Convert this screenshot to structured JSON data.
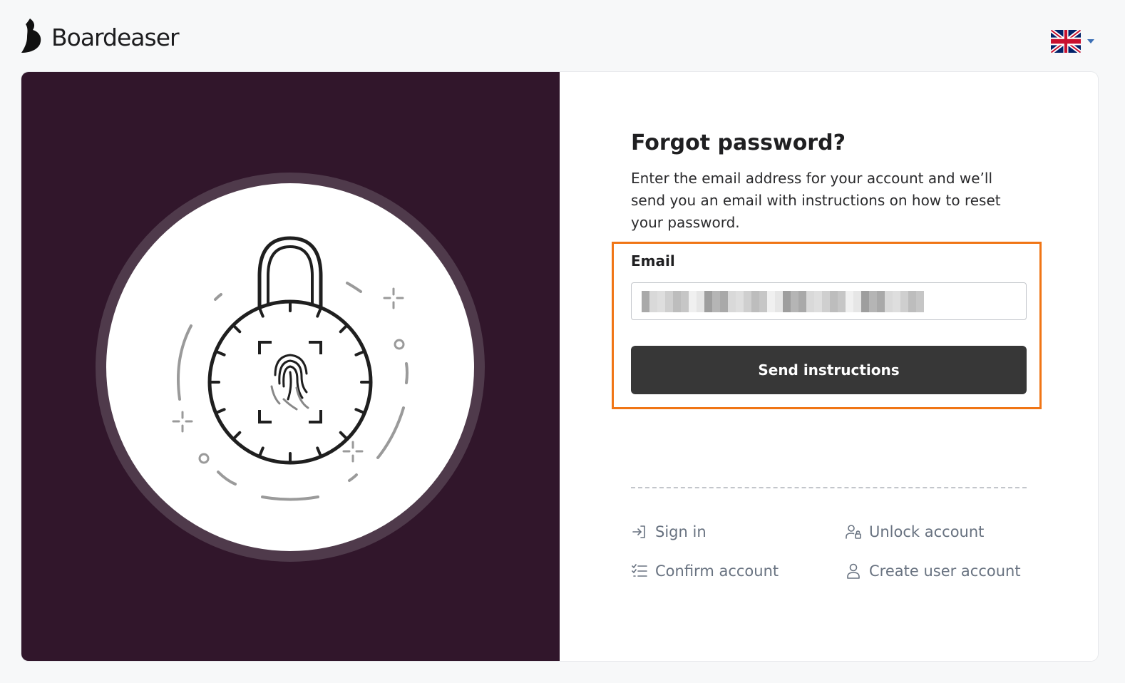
{
  "brand": {
    "name": "Boardeaser"
  },
  "language": {
    "selected": "English (UK)",
    "icon": "uk-flag-icon"
  },
  "form": {
    "title": "Forgot password?",
    "description": "Enter the email address for your account and we’ll send you an email with instructions on how to reset your password.",
    "email_label": "Email",
    "email_value_redacted": true,
    "submit_label": "Send instructions"
  },
  "links": [
    {
      "label": "Sign in",
      "icon": "sign-in-icon"
    },
    {
      "label": "Unlock account",
      "icon": "user-lock-icon"
    },
    {
      "label": "Confirm account",
      "icon": "checklist-icon"
    },
    {
      "label": "Create user account",
      "icon": "user-icon"
    }
  ],
  "colors": {
    "panel_bg": "#31162b",
    "button_bg": "#373737",
    "highlight": "#f07515",
    "link_text": "#687280"
  }
}
